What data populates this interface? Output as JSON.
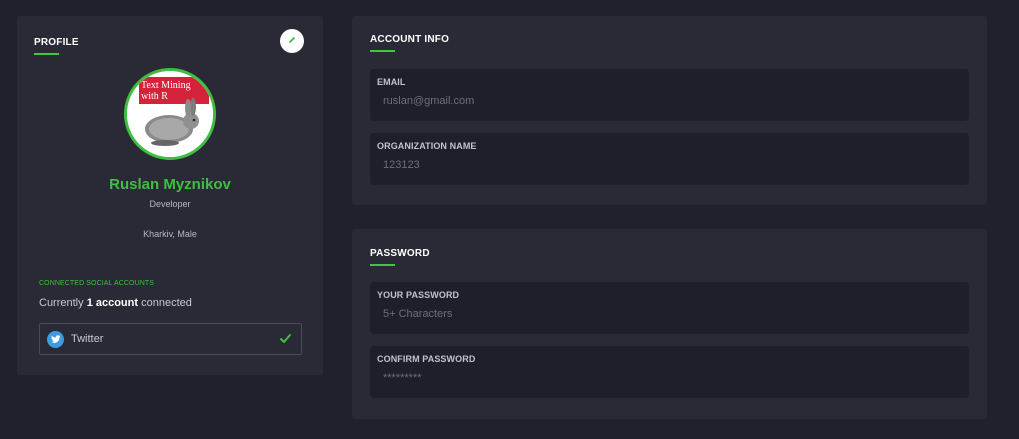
{
  "profile": {
    "title": "PROFILE",
    "avatar_icon": "book-cover-rabbit-icon",
    "avatar_text_line1": "Text Mining",
    "avatar_text_line2": "with R",
    "name": "Ruslan Myznikov",
    "role": "Developer",
    "location": "Kharkiv, Male",
    "social_label": "CONNECTED SOCIAL ACCOUNTS",
    "social_count_prefix": "Currently",
    "social_count_bold": "1 account",
    "social_count_suffix": "connected",
    "social_accounts": [
      {
        "name": "Twitter",
        "icon": "twitter-icon",
        "connected": true
      }
    ]
  },
  "account_info": {
    "title": "ACCOUNT INFO",
    "email_label": "EMAIL",
    "email_value": "ruslan@gmail.com",
    "org_label": "ORGANIZATION NAME",
    "org_value": "123123"
  },
  "password": {
    "title": "PASSWORD",
    "your_password_label": "YOUR PASSWORD",
    "your_password_placeholder": "5+ Characters",
    "confirm_label": "CONFIRM PASSWORD",
    "confirm_value": "*********"
  },
  "colors": {
    "background": "#21212c",
    "card": "#2a2a37",
    "field": "#1f1f2a",
    "accent": "#3fbf3f",
    "twitter": "#3d9be4"
  }
}
